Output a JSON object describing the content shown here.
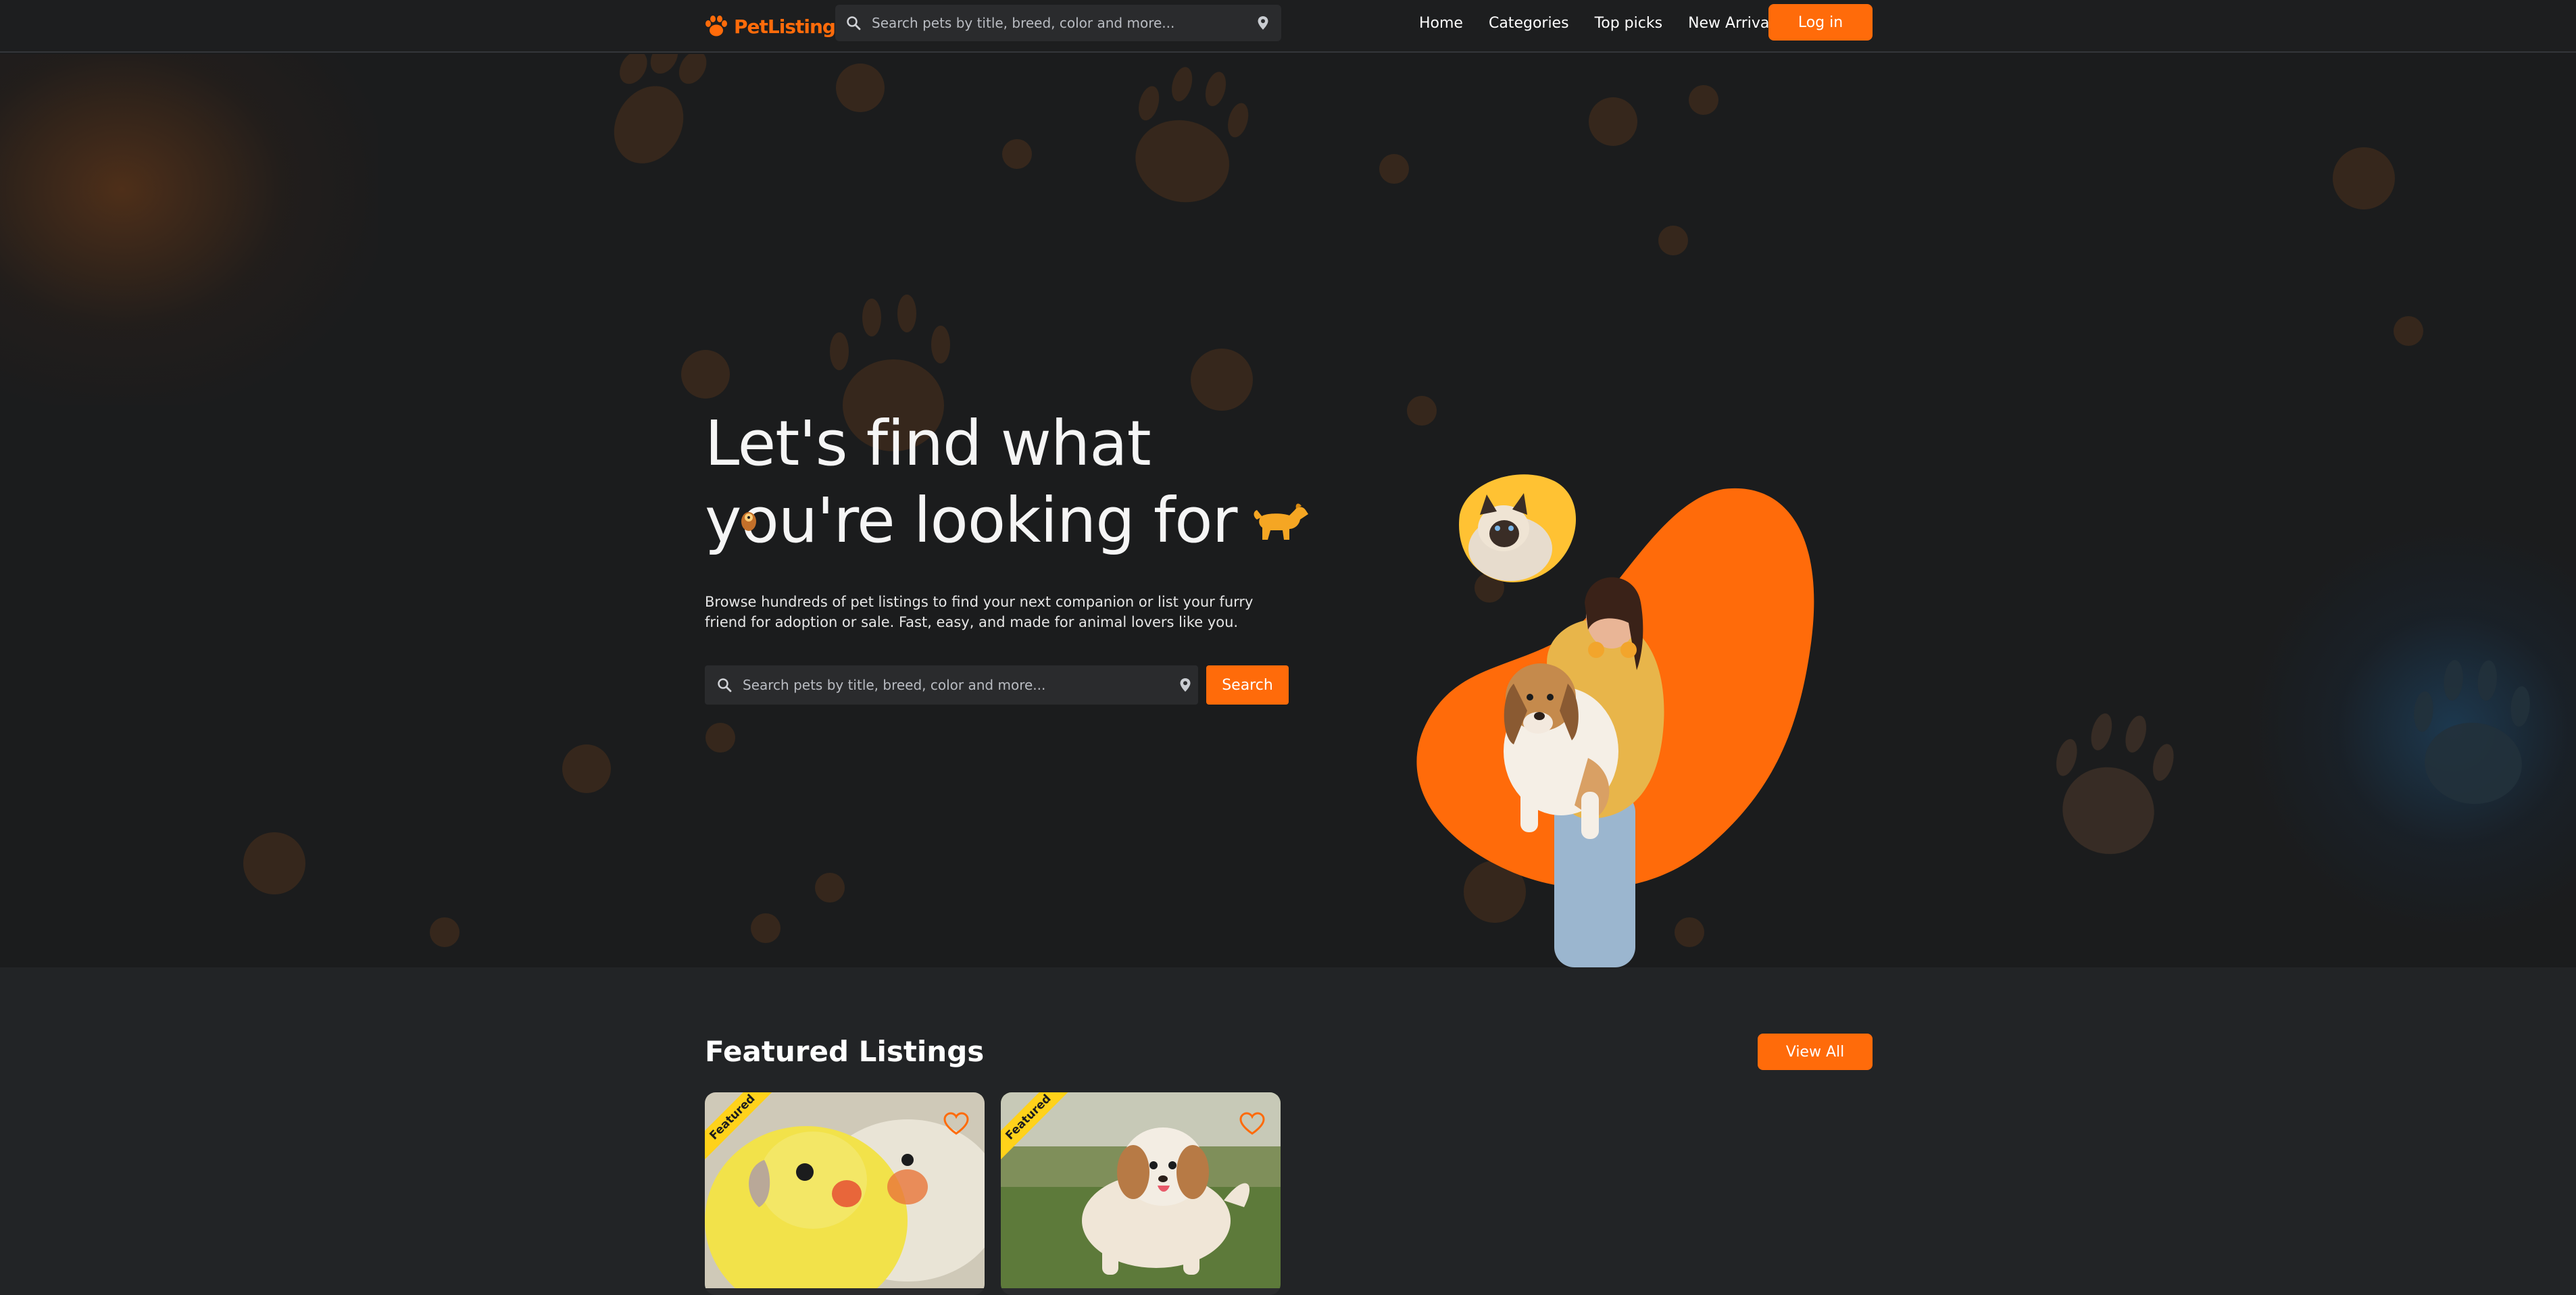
{
  "brand": {
    "name": "PetListings",
    "accent": "#ff6b0a"
  },
  "nav": {
    "search_placeholder": "Search pets by title, breed, color and more...",
    "links": [
      "Home",
      "Categories",
      "Top picks",
      "New Arrivals"
    ],
    "login_label": "Log in"
  },
  "hero": {
    "title_line1": "Let's find what",
    "title_line2": "you're looking for",
    "description": "Browse hundreds of pet listings to find your next companion or list your furry friend for adoption or sale. Fast, easy, and made for animal lovers like you.",
    "search_placeholder": "Search pets by title, breed, color and more...",
    "search_button": "Search"
  },
  "featured": {
    "title": "Featured Listings",
    "view_all_label": "View All",
    "cards": [
      {
        "badge": "Featured",
        "animal": "cockatiel"
      },
      {
        "badge": "Featured",
        "animal": "shih tzu"
      }
    ]
  },
  "colors": {
    "background": "#1b1c1d",
    "section_bg": "#222426",
    "accent": "#ff6b0a",
    "badge": "#ffd21a"
  }
}
